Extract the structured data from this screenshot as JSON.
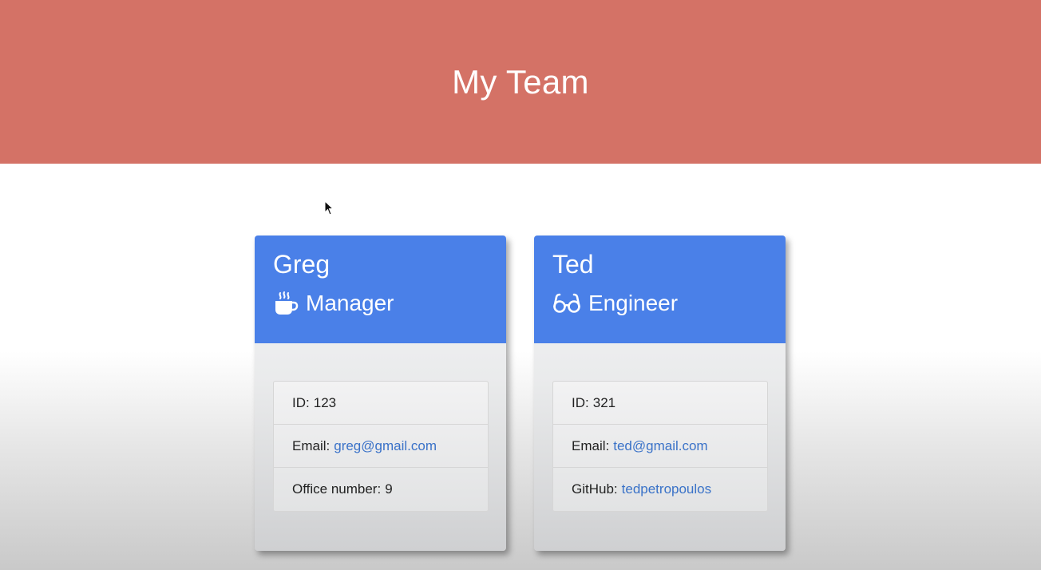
{
  "header": {
    "title": "My Team"
  },
  "colors": {
    "header_bg": "#d47266",
    "card_head_bg": "#4a80e8",
    "link": "#3a72c8"
  },
  "cards": [
    {
      "name": "Greg",
      "role": "Manager",
      "role_icon": "coffee-mug-icon",
      "items": [
        {
          "label": "ID:",
          "value": "123",
          "is_link": false
        },
        {
          "label": "Email:",
          "value": "greg@gmail.com",
          "is_link": true
        },
        {
          "label": "Office number:",
          "value": "9",
          "is_link": false
        }
      ]
    },
    {
      "name": "Ted",
      "role": "Engineer",
      "role_icon": "glasses-icon",
      "items": [
        {
          "label": "ID:",
          "value": "321",
          "is_link": false
        },
        {
          "label": "Email:",
          "value": "ted@gmail.com",
          "is_link": true
        },
        {
          "label": "GitHub:",
          "value": "tedpetropoulos",
          "is_link": true
        }
      ]
    }
  ]
}
